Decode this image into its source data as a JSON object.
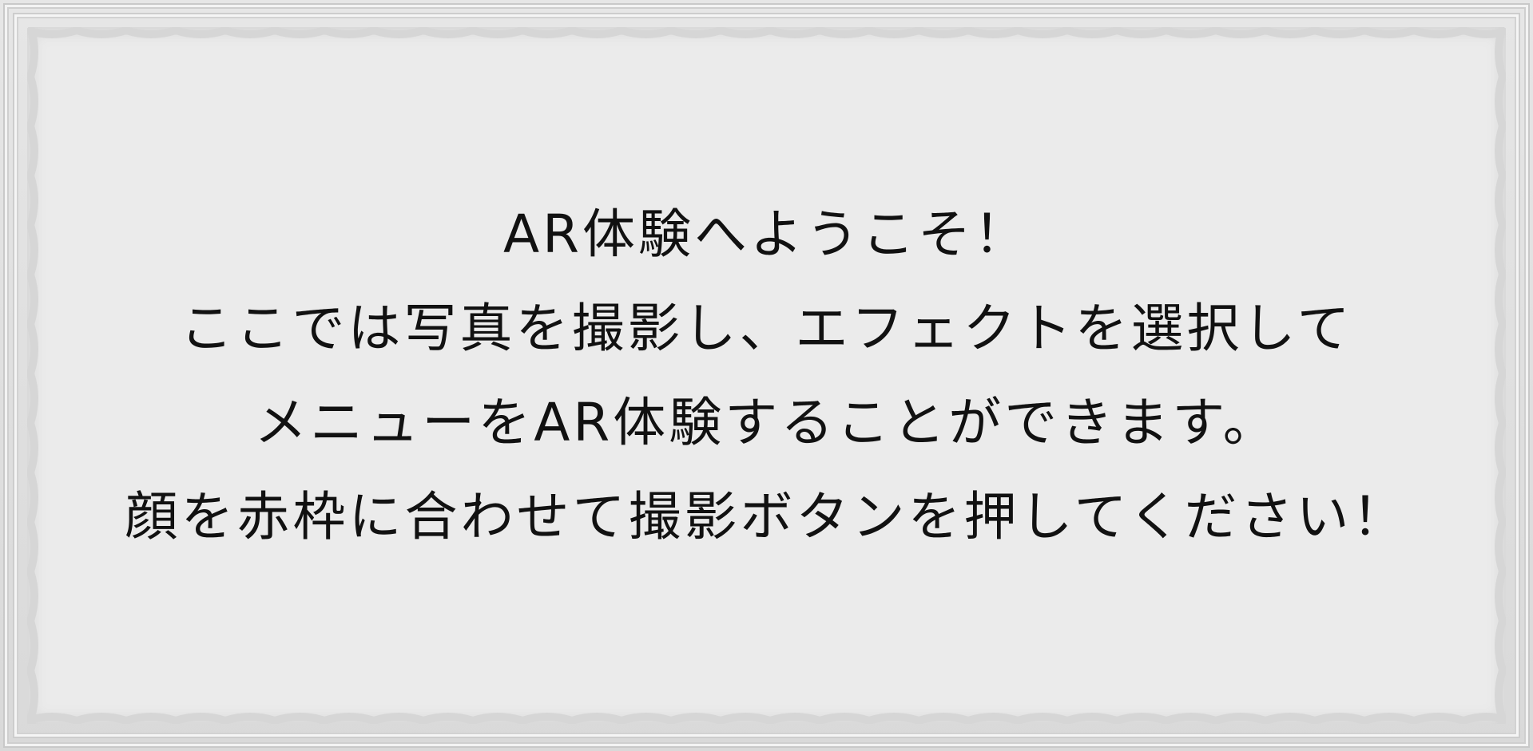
{
  "dialog": {
    "lines": [
      "AR体験へようこそ！",
      "ここでは写真を撮影し、エフェクトを選択して",
      "メニューをAR体験することができます。",
      "顔を赤枠に合わせて撮影ボタンを押してください！"
    ]
  },
  "colors": {
    "background": "#ebebeb",
    "frame": "#d9d9d9",
    "text": "#111111"
  }
}
